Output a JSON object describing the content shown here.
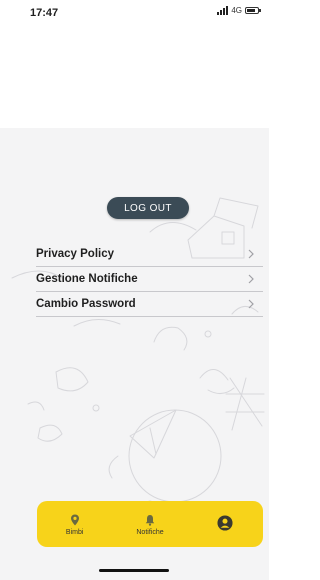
{
  "status_bar": {
    "time": "17:47",
    "network": "4G",
    "icons": [
      "signal-icon",
      "battery-icon"
    ]
  },
  "actions": {
    "logout_label": "LOG OUT"
  },
  "settings_menu": [
    {
      "label": "Privacy Policy",
      "icon": "chevron-right-icon"
    },
    {
      "label": "Gestione Notifiche",
      "icon": "chevron-right-icon"
    },
    {
      "label": "Cambio Password",
      "icon": "chevron-right-icon"
    }
  ],
  "bottom_nav": [
    {
      "label": "Bimbi",
      "icon": "map-pin-icon"
    },
    {
      "label": "Notifiche",
      "icon": "bell-icon"
    },
    {
      "label": "",
      "icon": "profile-icon",
      "active": true
    }
  ],
  "colors": {
    "accent": "#f7d31a",
    "button": "#3b4b56",
    "panel": "#f4f4f5",
    "divider": "#c8c8cc"
  }
}
